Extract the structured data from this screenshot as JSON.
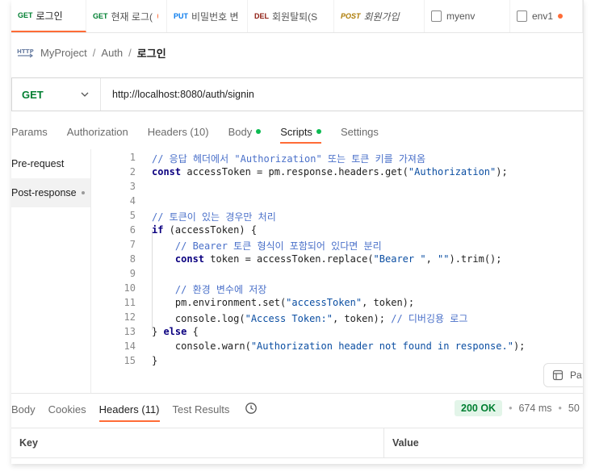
{
  "tabs": [
    {
      "method": "GET",
      "method_color": "#007f31",
      "label": "로그인",
      "active": true,
      "dot": false
    },
    {
      "method": "GET",
      "method_color": "#007f31",
      "label": "현재 로그(",
      "active": false,
      "dot": true
    },
    {
      "method": "PUT",
      "method_color": "#097bed",
      "label": "비밀번호 변",
      "active": false,
      "dot": false
    },
    {
      "method": "DEL",
      "method_color": "#8e1a10",
      "label": "회원탈퇴(S",
      "active": false,
      "dot": false
    },
    {
      "method": "POST",
      "method_color": "#ad7a03",
      "label": "회원가입",
      "active": false,
      "dot": false
    },
    {
      "method": "",
      "method_color": "",
      "label": "myenv",
      "active": false,
      "dot": false,
      "env": true
    },
    {
      "method": "",
      "method_color": "",
      "label": "env1",
      "active": false,
      "dot": true,
      "env": true
    }
  ],
  "breadcrumb": {
    "icon": "http-icon",
    "project": "MyProject",
    "folder": "Auth",
    "current": "로그인"
  },
  "request": {
    "method": "GET",
    "url": "http://localhost:8080/auth/signin"
  },
  "request_tabs": [
    {
      "label": "Params",
      "active": false,
      "dot": false
    },
    {
      "label": "Authorization",
      "active": false,
      "dot": false
    },
    {
      "label": "Headers (10)",
      "active": false,
      "dot": false
    },
    {
      "label": "Body",
      "active": false,
      "dot": true
    },
    {
      "label": "Scripts",
      "active": true,
      "dot": true
    },
    {
      "label": "Settings",
      "active": false,
      "dot": false
    }
  ],
  "script_sidebar": [
    {
      "label": "Pre-request",
      "active": false
    },
    {
      "label": "Post-response",
      "active": true
    }
  ],
  "code_lines": [
    {
      "n": "1",
      "tokens": [
        [
          "com",
          "// 응답 헤더에서 \"Authorization\" 또는 토큰 키를 가져옴"
        ]
      ]
    },
    {
      "n": "2",
      "tokens": [
        [
          "kw",
          "const"
        ],
        [
          "txt",
          " accessToken = pm.response.headers.get("
        ],
        [
          "str",
          "\"Authorization\""
        ],
        [
          "txt",
          ");"
        ]
      ]
    },
    {
      "n": "3",
      "tokens": []
    },
    {
      "n": "4",
      "tokens": []
    },
    {
      "n": "5",
      "tokens": [
        [
          "com",
          "// 토큰이 있는 경우만 처리"
        ]
      ]
    },
    {
      "n": "6",
      "tokens": [
        [
          "kw",
          "if"
        ],
        [
          "txt",
          " (accessToken) {"
        ]
      ]
    },
    {
      "n": "7",
      "tokens": [
        [
          "txt",
          "    "
        ],
        [
          "com",
          "// Bearer 토큰 형식이 포함되어 있다면 분리"
        ]
      ]
    },
    {
      "n": "8",
      "tokens": [
        [
          "txt",
          "    "
        ],
        [
          "kw",
          "const"
        ],
        [
          "txt",
          " token = accessToken.replace("
        ],
        [
          "str",
          "\"Bearer \""
        ],
        [
          "txt",
          ", "
        ],
        [
          "str",
          "\"\""
        ],
        [
          "txt",
          ").trim();"
        ]
      ]
    },
    {
      "n": "9",
      "tokens": []
    },
    {
      "n": "10",
      "tokens": [
        [
          "txt",
          "    "
        ],
        [
          "com",
          "// 환경 변수에 저장"
        ]
      ]
    },
    {
      "n": "11",
      "tokens": [
        [
          "txt",
          "    pm.environment.set("
        ],
        [
          "str",
          "\"accessToken\""
        ],
        [
          "txt",
          ", token);"
        ]
      ]
    },
    {
      "n": "12",
      "tokens": [
        [
          "txt",
          "    console.log("
        ],
        [
          "str",
          "\"Access Token:\""
        ],
        [
          "txt",
          ", token); "
        ],
        [
          "com",
          "// 디버깅용 로그"
        ]
      ]
    },
    {
      "n": "13",
      "tokens": [
        [
          "txt",
          "} "
        ],
        [
          "kw",
          "else"
        ],
        [
          "txt",
          " {"
        ]
      ]
    },
    {
      "n": "14",
      "tokens": [
        [
          "txt",
          "    console.warn("
        ],
        [
          "str",
          "\"Authorization header not found in response.\""
        ],
        [
          "txt",
          ");"
        ]
      ]
    },
    {
      "n": "15",
      "tokens": [
        [
          "txt",
          "}"
        ]
      ]
    }
  ],
  "packages_button": "Pa",
  "response_tabs": [
    {
      "label": "Body",
      "active": false
    },
    {
      "label": "Cookies",
      "active": false
    },
    {
      "label": "Headers (11)",
      "active": true
    },
    {
      "label": "Test Results",
      "active": false
    }
  ],
  "response_status": {
    "code": "200 OK",
    "time": "674 ms",
    "size": "50"
  },
  "response_table": {
    "columns": [
      "Key",
      "Value"
    ]
  },
  "colors": {
    "accent": "#ff6c37",
    "get": "#007f31",
    "success_bg": "#e3f5e9",
    "comment": "#4a70c9",
    "keyword": "#0b0080",
    "string": "#0b4ea2"
  }
}
